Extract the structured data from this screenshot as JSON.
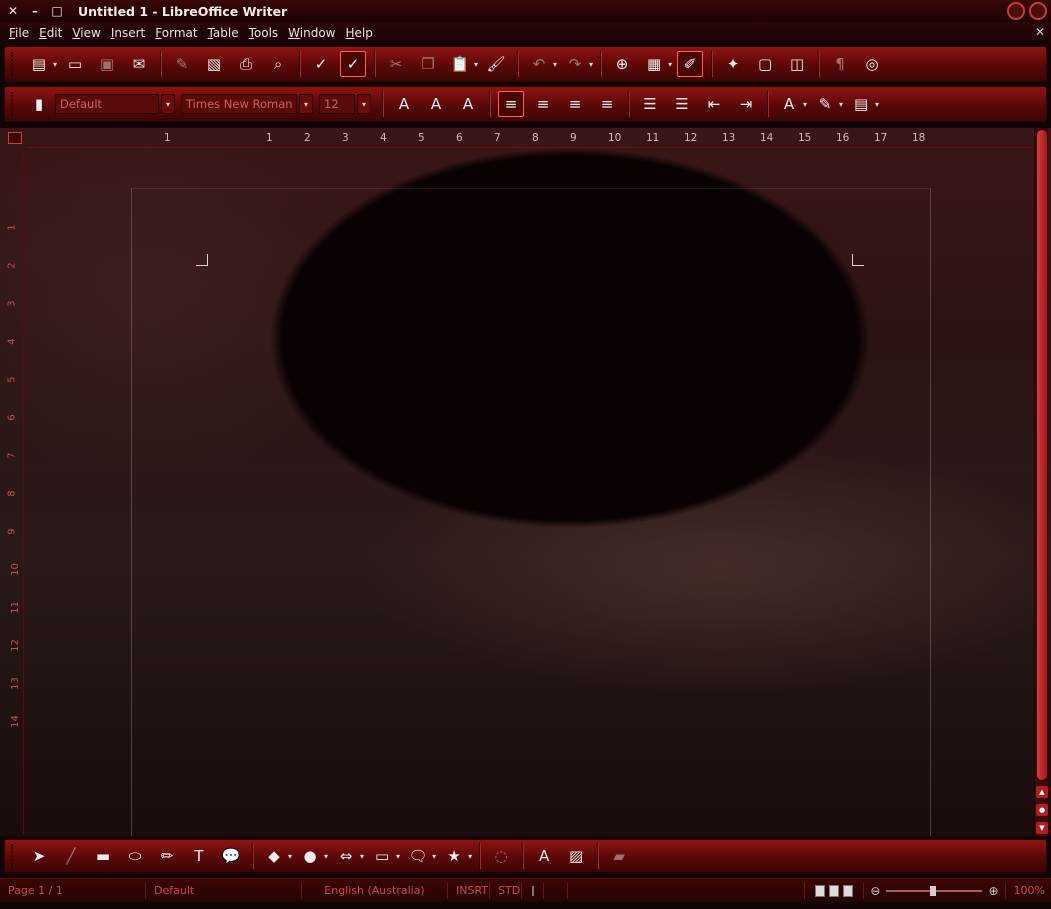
{
  "window": {
    "title": "Untitled 1 - LibreOffice Writer",
    "close_glyph": "✕",
    "minimize_glyph": "–",
    "maximize_glyph": "□"
  },
  "menu": {
    "items": [
      "File",
      "Edit",
      "View",
      "Insert",
      "Format",
      "Table",
      "Tools",
      "Window",
      "Help"
    ],
    "doc_close_glyph": "✕"
  },
  "standard_toolbar": {
    "buttons": [
      {
        "name": "new-document",
        "icon": "new-document-icon",
        "glyph": "▤",
        "dropdown": true
      },
      {
        "name": "open",
        "icon": "open-folder-icon",
        "glyph": "▭"
      },
      {
        "name": "save",
        "icon": "save-disk-icon",
        "glyph": "▣",
        "dim": true
      },
      {
        "name": "email",
        "icon": "email-icon",
        "glyph": "✉"
      },
      {
        "name": "edit-file",
        "icon": "edit-file-icon",
        "glyph": "✎",
        "dim": true
      },
      {
        "name": "export-pdf",
        "icon": "pdf-icon",
        "glyph": "▧"
      },
      {
        "name": "print",
        "icon": "printer-icon",
        "glyph": "⎙"
      },
      {
        "name": "print-preview",
        "icon": "print-preview-icon",
        "glyph": "⌕"
      },
      {
        "name": "spellcheck",
        "icon": "spellcheck-icon",
        "glyph": "✓"
      },
      {
        "name": "autospellcheck",
        "icon": "autospellcheck-icon",
        "glyph": "✓",
        "active": true
      },
      {
        "name": "cut",
        "icon": "scissors-icon",
        "glyph": "✂",
        "dim": true
      },
      {
        "name": "copy",
        "icon": "copy-icon",
        "glyph": "❐",
        "dim": true
      },
      {
        "name": "paste",
        "icon": "paste-icon",
        "glyph": "📋",
        "dropdown": true
      },
      {
        "name": "clone-formatting",
        "icon": "paintbrush-icon",
        "glyph": "🖌"
      },
      {
        "name": "undo",
        "icon": "undo-icon",
        "glyph": "↶",
        "dropdown": true,
        "dim": true
      },
      {
        "name": "redo",
        "icon": "redo-icon",
        "glyph": "↷",
        "dropdown": true,
        "dim": true
      },
      {
        "name": "hyperlink",
        "icon": "hyperlink-globe-icon",
        "glyph": "⊕"
      },
      {
        "name": "table",
        "icon": "table-grid-icon",
        "glyph": "▦",
        "dropdown": true
      },
      {
        "name": "show-draw-functions",
        "icon": "draw-pencil-icon",
        "glyph": "✐",
        "active": true
      },
      {
        "name": "navigator",
        "icon": "navigator-star-icon",
        "glyph": "✦"
      },
      {
        "name": "gallery",
        "icon": "gallery-icon",
        "glyph": "▢"
      },
      {
        "name": "data-sources",
        "icon": "data-sources-icon",
        "glyph": "◫"
      },
      {
        "name": "formatting-marks",
        "icon": "pilcrow-icon",
        "glyph": "¶",
        "dim": true
      },
      {
        "name": "help",
        "icon": "lifebuoy-help-icon",
        "glyph": "◎"
      }
    ]
  },
  "formatting_toolbar": {
    "style_grip_glyph": "▮",
    "paragraph_style": "Default",
    "font_name": "Times New Roman",
    "font_size": "12",
    "dropdown_glyph": "▾",
    "buttons": [
      {
        "name": "bold",
        "icon": "bold-a-icon",
        "glyph": "A"
      },
      {
        "name": "italic",
        "icon": "italic-a-icon",
        "glyph": "A"
      },
      {
        "name": "underline",
        "icon": "underline-a-icon",
        "glyph": "A"
      },
      {
        "name": "align-left",
        "icon": "align-left-icon",
        "glyph": "≡",
        "active": true
      },
      {
        "name": "align-center",
        "icon": "align-center-icon",
        "glyph": "≡"
      },
      {
        "name": "align-right",
        "icon": "align-right-icon",
        "glyph": "≡"
      },
      {
        "name": "justify",
        "icon": "justify-icon",
        "glyph": "≡"
      },
      {
        "name": "numbering",
        "icon": "numbered-list-icon",
        "glyph": "☰"
      },
      {
        "name": "bullets",
        "icon": "bulleted-list-icon",
        "glyph": "☰"
      },
      {
        "name": "decrease-indent",
        "icon": "decrease-indent-icon",
        "glyph": "⇤"
      },
      {
        "name": "increase-indent",
        "icon": "increase-indent-icon",
        "glyph": "⇥"
      },
      {
        "name": "font-color",
        "icon": "font-color-icon",
        "glyph": "A",
        "dropdown": true
      },
      {
        "name": "highlighting",
        "icon": "highlighter-icon",
        "glyph": "✎",
        "dropdown": true
      },
      {
        "name": "background-color",
        "icon": "background-color-icon",
        "glyph": "▤",
        "dropdown": true
      }
    ]
  },
  "ruler": {
    "horizontal_labels": [
      "1",
      "1",
      "2",
      "3",
      "4",
      "5",
      "6",
      "7",
      "8",
      "9",
      "10",
      "11",
      "12",
      "13",
      "14",
      "15",
      "16",
      "17",
      "18"
    ],
    "vertical_labels": [
      "1",
      "2",
      "3",
      "4",
      "5",
      "6",
      "7",
      "8",
      "9",
      "10",
      "11",
      "12",
      "13",
      "14"
    ]
  },
  "scrollbar": {
    "up_glyph": "▲",
    "mid_glyph": "●",
    "down_glyph": "▼"
  },
  "drawing_toolbar": {
    "buttons": [
      {
        "name": "select",
        "icon": "select-arrow-icon",
        "glyph": "➤"
      },
      {
        "name": "line",
        "icon": "line-icon",
        "glyph": "╱",
        "dim": true
      },
      {
        "name": "rectangle",
        "icon": "rectangle-icon",
        "glyph": "▬"
      },
      {
        "name": "ellipse",
        "icon": "ellipse-icon",
        "glyph": "⬭"
      },
      {
        "name": "freeform-line",
        "icon": "freeform-pencil-icon",
        "glyph": "✏"
      },
      {
        "name": "text",
        "icon": "text-t-icon",
        "glyph": "T"
      },
      {
        "name": "callouts",
        "icon": "callout-bubble-icon",
        "glyph": "💬"
      },
      {
        "name": "basic-shapes",
        "icon": "diamond-shape-icon",
        "glyph": "◆",
        "dropdown": true
      },
      {
        "name": "symbol-shapes",
        "icon": "circle-shape-icon",
        "glyph": "●",
        "dropdown": true
      },
      {
        "name": "block-arrows",
        "icon": "double-arrow-icon",
        "glyph": "⇔",
        "dropdown": true
      },
      {
        "name": "flowchart",
        "icon": "flowchart-icon",
        "glyph": "▭",
        "dropdown": true
      },
      {
        "name": "callout-shapes",
        "icon": "speech-shape-icon",
        "glyph": "🗨",
        "dropdown": true
      },
      {
        "name": "stars",
        "icon": "star-icon",
        "glyph": "★",
        "dropdown": true
      },
      {
        "name": "points",
        "icon": "points-icon",
        "glyph": "◌",
        "dim": true
      },
      {
        "name": "fontwork",
        "icon": "fontwork-icon",
        "glyph": "A"
      },
      {
        "name": "from-file",
        "icon": "insert-image-icon",
        "glyph": "▨"
      },
      {
        "name": "extrusion",
        "icon": "extrusion-icon",
        "glyph": "▰",
        "dim": true
      }
    ]
  },
  "status": {
    "page": "Page 1 / 1",
    "page_style": "Default",
    "language": "English (Australia)",
    "insert_mode": "INSRT",
    "selection_mode": "STD",
    "zoom": "100%",
    "zoom_out_glyph": "⊖",
    "zoom_in_glyph": "⊕"
  }
}
